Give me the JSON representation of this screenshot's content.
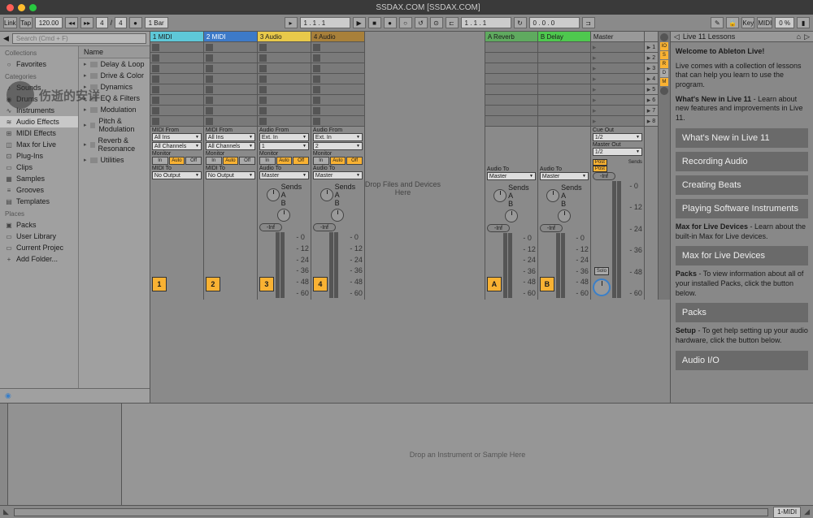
{
  "window_title": "SSDAX.COM  [SSDAX.COM]",
  "toolbar": {
    "link": "Link",
    "tap": "Tap",
    "tempo": "120.00",
    "sig_a": "4",
    "sig_b": "4",
    "bars": "1 Bar",
    "pos": "1 .  1 .  1",
    "loop_pos": "1 .  1 .  1",
    "loop_len": "0 .  0 .  0",
    "key": "Key",
    "midi": "MIDI",
    "pct": "0 %"
  },
  "browser": {
    "search_placeholder": "Search (Cmd + F)",
    "sections": {
      "collections": "Collections",
      "favorites": "Favorites",
      "categories": "Categories",
      "places": "Places"
    },
    "categories": [
      {
        "label": "Sounds",
        "icon": "♪"
      },
      {
        "label": "Drums",
        "icon": "◉"
      },
      {
        "label": "Instruments",
        "icon": "∿"
      },
      {
        "label": "Audio Effects",
        "icon": "≋",
        "selected": true
      },
      {
        "label": "MIDI Effects",
        "icon": "⊞"
      },
      {
        "label": "Max for Live",
        "icon": "◫"
      },
      {
        "label": "Plug-Ins",
        "icon": "⊡"
      },
      {
        "label": "Clips",
        "icon": "▭"
      },
      {
        "label": "Samples",
        "icon": "▦"
      },
      {
        "label": "Grooves",
        "icon": "≡"
      },
      {
        "label": "Templates",
        "icon": "▤"
      }
    ],
    "places": [
      {
        "label": "Packs",
        "icon": "▣"
      },
      {
        "label": "User Library",
        "icon": "▭"
      },
      {
        "label": "Current Projec",
        "icon": "▭"
      },
      {
        "label": "Add Folder...",
        "icon": "+"
      }
    ],
    "name_header": "Name",
    "items": [
      "Delay & Loop",
      "Drive & Color",
      "Dynamics",
      "EQ & Filters",
      "Modulation",
      "Pitch & Modulation",
      "Reverb & Resonance",
      "Utilities"
    ]
  },
  "watermark": "伤逝的安详",
  "tracks": {
    "headers": [
      {
        "label": "1 MIDI",
        "cls": "th-cyan"
      },
      {
        "label": "2 MIDI",
        "cls": "th-blue"
      },
      {
        "label": "3 Audio",
        "cls": "th-yellow"
      },
      {
        "label": "4 Audio",
        "cls": "th-brown"
      }
    ],
    "returns": [
      {
        "label": "A Reverb",
        "cls": "th-green1"
      },
      {
        "label": "B Delay",
        "cls": "th-green2"
      }
    ],
    "master": "Master",
    "drop_text": "Drop Files and Devices\nHere",
    "scene_count": 8,
    "io": {
      "midi_from": "MIDI From",
      "audio_from": "Audio From",
      "all_ins": "All Ins",
      "all_ch": "All Channels",
      "ext_in": "Ext. In",
      "ch1": "1",
      "ch2": "2",
      "monitor": "Monitor",
      "in": "In",
      "auto": "Auto",
      "off": "Off",
      "midi_to": "MIDI To",
      "audio_to": "Audio To",
      "no_output": "No Output",
      "master": "Master",
      "cue_out": "Cue Out",
      "master_out": "Master Out",
      "out12": "1/2"
    },
    "mixer": {
      "sends": "Sends",
      "inf": "-Inf",
      "solo": "Solo",
      "post": "Post",
      "scale": [
        "0",
        "12",
        "24",
        "36",
        "48",
        "60"
      ],
      "nums": [
        "1",
        "2",
        "3",
        "4"
      ],
      "rets": [
        "A",
        "B"
      ]
    }
  },
  "help": {
    "header": "Live 11 Lessons",
    "welcome": "Welcome to Ableton Live!",
    "intro": "Live comes with a collection of lessons that can help you learn to use the program.",
    "whats_new_desc": "What's New in Live 11 - Learn about new features and improvements in Live 11.",
    "lessons": [
      "What's New in Live 11",
      "Recording Audio",
      "Creating Beats",
      "Playing Software Instruments"
    ],
    "max_desc": "Max for Live Devices - Learn about the built-in Max for Live devices.",
    "max_btn": "Max for Live Devices",
    "packs_desc": "Packs - To view information about all of your installed Packs, click the button below.",
    "packs_btn": "Packs",
    "setup_desc": "Setup - To get help setting up your audio hardware, click the button below.",
    "audio_btn": "Audio I/O"
  },
  "detail": {
    "drop": "Drop an Instrument or Sample Here"
  },
  "status": {
    "track": "1-MIDI"
  }
}
